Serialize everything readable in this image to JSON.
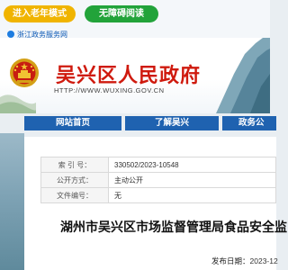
{
  "topbar": {
    "elder_mode": "进入老年模式",
    "barrier_free": "无障碍阅读",
    "zj_service": "浙江政务服务网"
  },
  "header": {
    "site_name": "吴兴区人民政府",
    "site_url": "HTTP://WWW.WUXING.GOV.CN"
  },
  "nav": {
    "items": [
      "网站首页",
      "了解吴兴",
      "政务公"
    ]
  },
  "meta": {
    "rows": [
      {
        "key": "索 引 号：",
        "value": "330502/2023-10548"
      },
      {
        "key": "公开方式：",
        "value": "主动公开"
      },
      {
        "key": "文件编号：",
        "value": "无"
      }
    ]
  },
  "article": {
    "title": "湖州市吴兴区市场监督管理局食品安全监",
    "date_label": "发布日期：",
    "date_value": "2023-12"
  },
  "colors": {
    "elder_pill": "#f0b400",
    "barrier_pill": "#22a33a",
    "nav_bg": "#1f62b0",
    "site_name": "#cf1a0e"
  }
}
